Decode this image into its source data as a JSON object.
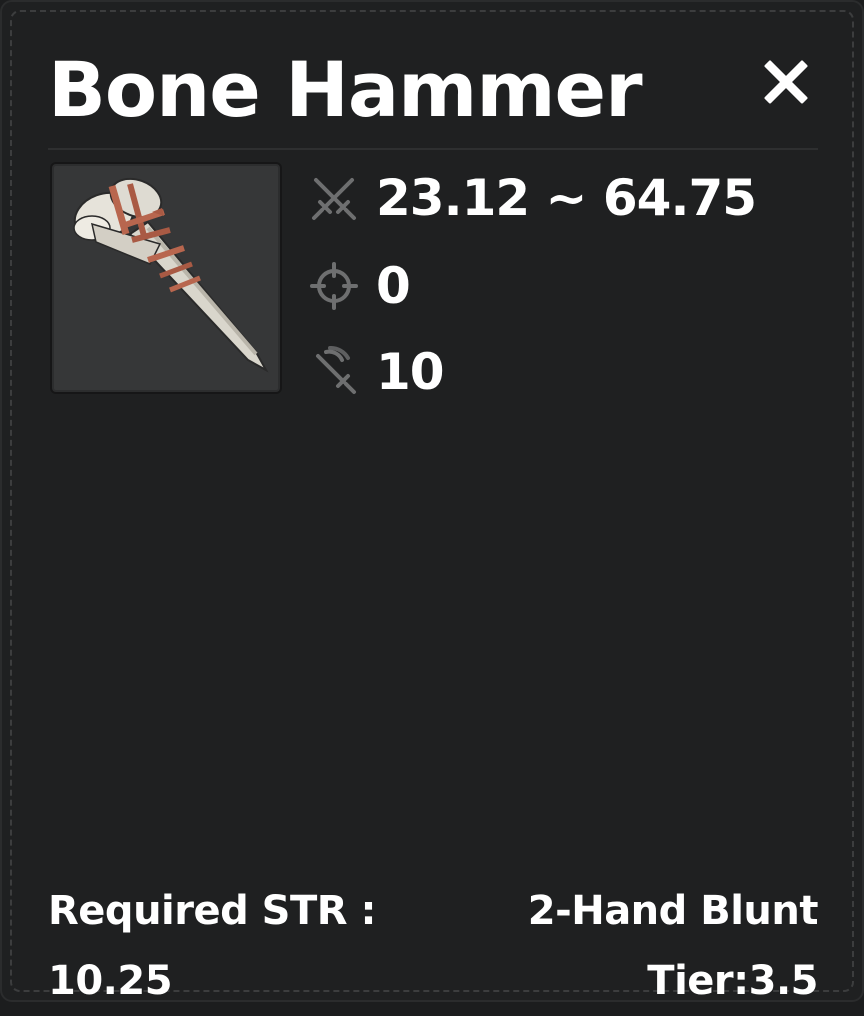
{
  "item": {
    "name": "Bone Hammer",
    "image_icon": "bone-hammer-icon"
  },
  "close": {
    "icon": "close-icon"
  },
  "stats": [
    {
      "icon": "crossed-swords-icon",
      "value": "23.12 ~ 64.75"
    },
    {
      "icon": "crosshair-icon",
      "value": "0"
    },
    {
      "icon": "sword-signal-icon",
      "value": "10"
    }
  ],
  "requirements": {
    "label": "Required STR :",
    "value": "10.25"
  },
  "weapon": {
    "type": "2-Hand Blunt",
    "tier": "Tier:3.5"
  },
  "colors": {
    "panel_bg": "#1f2021",
    "text": "#ffffff",
    "icon_gray": "#6e6f70",
    "frame_bg": "#363738"
  }
}
